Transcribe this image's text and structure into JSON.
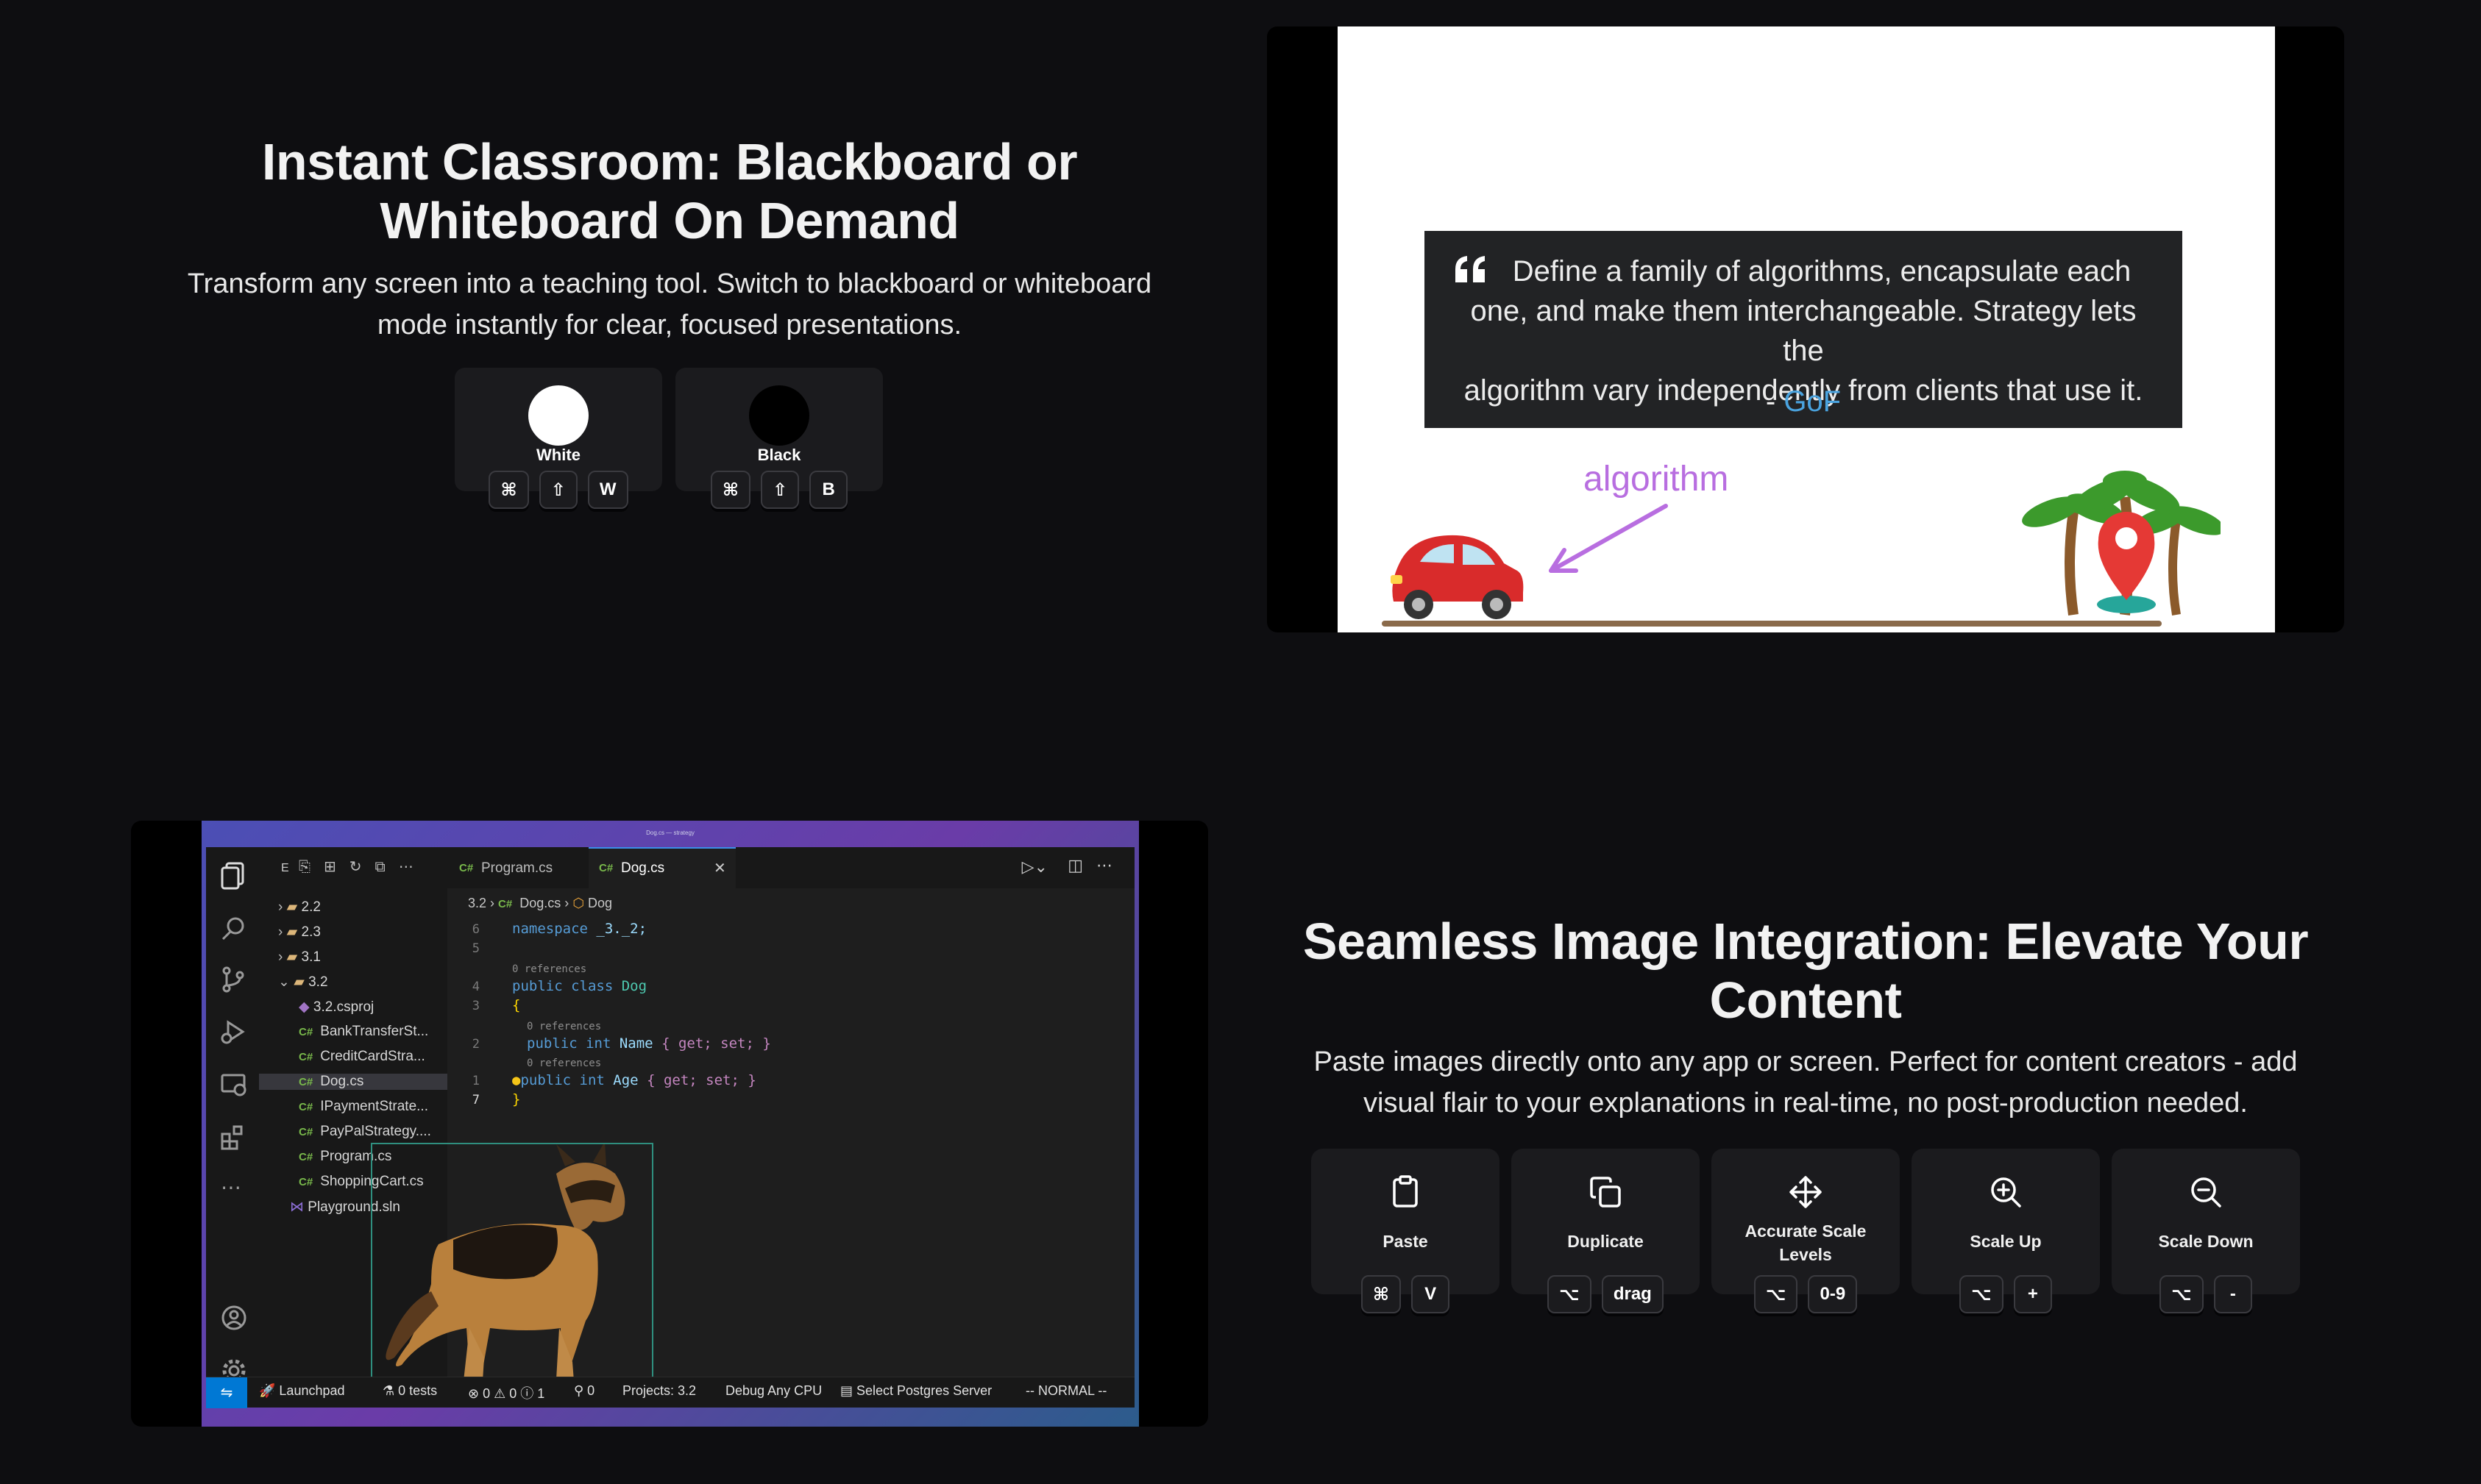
{
  "section1": {
    "title_line1": "Instant Classroom: Blackboard or",
    "title_line2": "Whiteboard On Demand",
    "subtitle_line1": "Transform any screen into a teaching tool. Switch to blackboard or whiteboard",
    "subtitle_line2": "mode instantly for clear, focused presentations.",
    "modes": [
      {
        "label": "White",
        "color": "#ffffff",
        "keys": [
          "⌘",
          "⇧",
          "W"
        ]
      },
      {
        "label": "Black",
        "color": "#000000",
        "keys": [
          "⌘",
          "⇧",
          "B"
        ]
      }
    ]
  },
  "whiteboard": {
    "quote_line1": "Define a family of algorithms, encapsulate each",
    "quote_line2": "one, and make them interchangeable. Strategy lets the",
    "quote_line3": "algorithm vary independently from clients that use it.",
    "attribution_prefix": "- ",
    "attribution": "GoF",
    "annotation": "algorithm",
    "accent_color": "#4aa3df",
    "annotation_color": "#b86ee0"
  },
  "editor": {
    "window_title": "Dog.cs — strategy",
    "toolbar_label": "E",
    "tabs": [
      {
        "label": "Program.cs",
        "active": false
      },
      {
        "label": "Dog.cs",
        "active": true
      }
    ],
    "breadcrumb": {
      "folder": "3.2",
      "file": "Dog.cs",
      "symbol": "Dog"
    },
    "tree": [
      {
        "label": "2.2",
        "kind": "folder"
      },
      {
        "label": "2.3",
        "kind": "folder"
      },
      {
        "label": "3.1",
        "kind": "folder"
      },
      {
        "label": "3.2",
        "kind": "folder-open"
      },
      {
        "label": "3.2.csproj",
        "kind": "csproj"
      },
      {
        "label": "BankTransferSt...",
        "kind": "cs"
      },
      {
        "label": "CreditCardStra...",
        "kind": "cs"
      },
      {
        "label": "Dog.cs",
        "kind": "cs"
      },
      {
        "label": "IPaymentStrate...",
        "kind": "cs"
      },
      {
        "label": "PayPalStrategy....",
        "kind": "cs"
      },
      {
        "label": "Program.cs",
        "kind": "cs"
      },
      {
        "label": "ShoppingCart.cs",
        "kind": "cs"
      },
      {
        "label": "Playground.sln",
        "kind": "sln"
      }
    ],
    "cs_badge": "C#",
    "code": {
      "ln6": "6",
      "ln5": "5",
      "ln4": "4",
      "ln3": "3",
      "ln2": "2",
      "ln1": "1",
      "ln7": "7",
      "namespace_kw": "namespace",
      "namespace_name": "_3._2;",
      "refs": "0 references",
      "class_kw": "public class",
      "class_name": "Dog",
      "brace_open": "{",
      "brace_close": "}",
      "prop1_kw": "public int",
      "prop1_name": "Name",
      "prop_accessors": "{ get; set; }",
      "prop2_kw": "public int",
      "prop2_name": "Age"
    },
    "status": {
      "launchpad": "Launchpad",
      "tests": "0 tests",
      "problems": "⊗ 0 ⚠ 0 ⓘ 1",
      "ports": "⚲ 0",
      "projects": "Projects: 3.2",
      "debug": "Debug Any CPU",
      "postgres": "Select Postgres Server",
      "mode": "-- NORMAL --"
    }
  },
  "section2": {
    "title_line1": "Seamless Image Integration: Elevate Your",
    "title_line2": "Content",
    "subtitle_line1": "Paste images directly onto any app or screen. Perfect for content creators - add",
    "subtitle_line2": "visual flair to your explanations in real-time, no post-production needed.",
    "actions": [
      {
        "label": "Paste",
        "icon": "clipboard-icon",
        "keys": [
          "⌘",
          "V"
        ]
      },
      {
        "label": "Duplicate",
        "icon": "copy-icon",
        "keys": [
          "⌥",
          "drag"
        ]
      },
      {
        "label": "Accurate Scale Levels",
        "icon": "move-icon",
        "keys": [
          "⌥",
          "0-9"
        ]
      },
      {
        "label": "Scale Up",
        "icon": "zoom-in-icon",
        "keys": [
          "⌥",
          "+"
        ]
      },
      {
        "label": "Scale Down",
        "icon": "zoom-out-icon",
        "keys": [
          "⌥",
          "-"
        ]
      }
    ]
  }
}
